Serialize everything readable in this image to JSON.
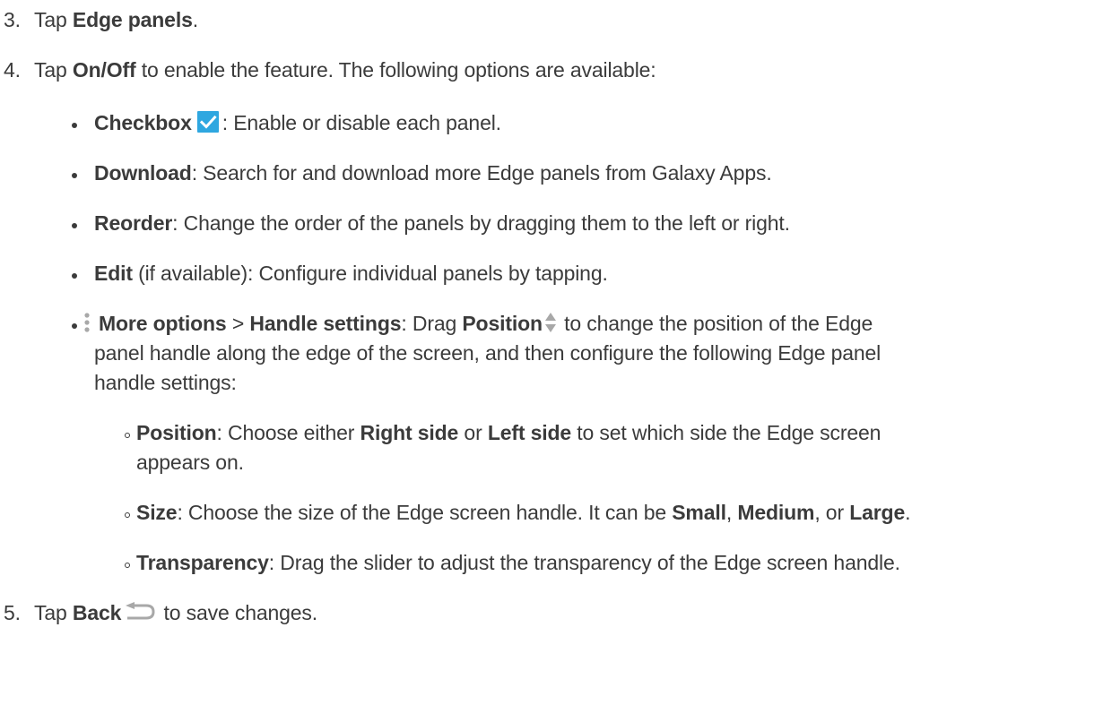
{
  "step3": {
    "number": "3.",
    "pre": "Tap ",
    "bold": "Edge panels",
    "post": "."
  },
  "step4": {
    "number": "4.",
    "pre": "Tap ",
    "bold": "On/Off",
    "post": " to enable the feature. The following options are available:"
  },
  "options": {
    "checkbox": {
      "bold": "Checkbox",
      "icon": "checkbox-checked-icon",
      "post": ": Enable or disable each panel."
    },
    "download": {
      "bold": "Download",
      "post": ": Search for and download more Edge panels from Galaxy Apps."
    },
    "reorder": {
      "bold": "Reorder",
      "post": ": Change the order of the panels by dragging them to the left or right."
    },
    "edit": {
      "bold": "Edit",
      "post": " (if available): Configure individual panels by tapping."
    },
    "more": {
      "icon": "more-options-icon",
      "bold1": "More options",
      "sep": " > ",
      "bold2": "Handle settings",
      "mid": ": Drag ",
      "bold3": "Position",
      "position_icon": "position-arrows-icon",
      "line1_post": " to change the position of the Edge",
      "line2": "panel handle along the edge of the screen, and then configure the following Edge panel",
      "line3": "handle settings:"
    }
  },
  "sub_options": {
    "position": {
      "bold": "Position",
      "t1": ": Choose either ",
      "bold2": "Right side",
      "t2": " or ",
      "bold3": "Left side",
      "t3": " to set which side the Edge screen",
      "line2": "appears on."
    },
    "size": {
      "bold": "Size",
      "t1": ": Choose the size of the Edge screen handle. It can be ",
      "bold2": "Small",
      "t2": ", ",
      "bold3": "Medium",
      "t3": ", or ",
      "bold4": "Large",
      "t4": "."
    },
    "transparency": {
      "bold": "Transparency",
      "post": ": Drag the slider to adjust the transparency of the Edge screen handle."
    }
  },
  "step5": {
    "number": "5.",
    "pre": "Tap ",
    "bold": "Back",
    "icon": "back-icon",
    "post": " to save changes."
  },
  "colors": {
    "text": "#3b3b3b",
    "checkbox_accent": "#2fa7e0",
    "icon_gray": "#a8a8a8"
  }
}
